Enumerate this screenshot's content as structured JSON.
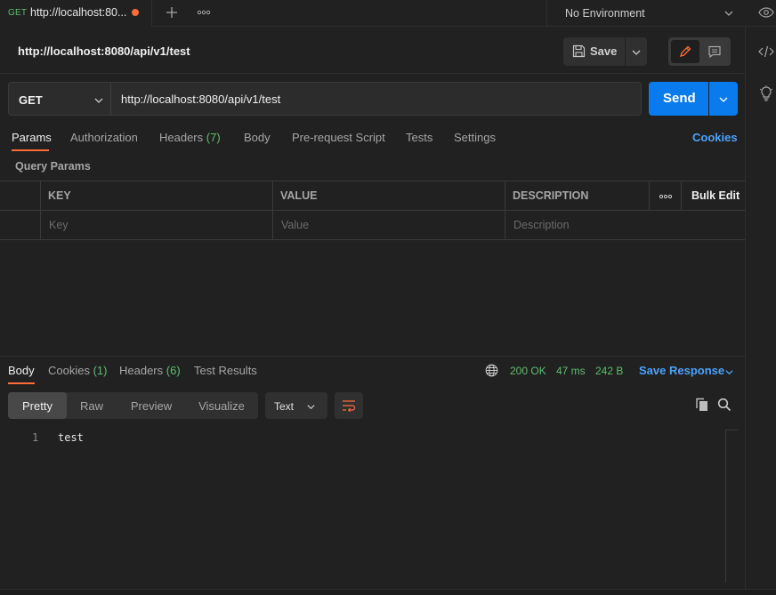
{
  "tab": {
    "method": "GET",
    "title": "http://localhost:80...",
    "unsaved_color": "#ff6c37"
  },
  "environment": {
    "selected": "No Environment"
  },
  "request": {
    "title": "http://localhost:8080/api/v1/test",
    "save_label": "Save",
    "method": "GET",
    "url": "http://localhost:8080/api/v1/test",
    "send_label": "Send"
  },
  "request_tabs": {
    "params": "Params",
    "authorization": "Authorization",
    "headers": "Headers",
    "headers_count": "(7)",
    "body": "Body",
    "prerequest": "Pre-request Script",
    "tests": "Tests",
    "settings": "Settings",
    "cookies": "Cookies"
  },
  "query_params": {
    "title": "Query Params",
    "columns": {
      "key": "KEY",
      "value": "VALUE",
      "description": "DESCRIPTION"
    },
    "bulk_edit": "Bulk Edit",
    "placeholders": {
      "key": "Key",
      "value": "Value",
      "description": "Description"
    }
  },
  "response": {
    "tabs": {
      "body": "Body",
      "cookies": "Cookies",
      "cookies_count": "(1)",
      "headers": "Headers",
      "headers_count": "(6)",
      "test_results": "Test Results"
    },
    "status": "200 OK",
    "time": "47 ms",
    "size": "242 B",
    "save_response": "Save Response",
    "views": {
      "pretty": "Pretty",
      "raw": "Raw",
      "preview": "Preview",
      "visualize": "Visualize"
    },
    "format": "Text",
    "lines": [
      {
        "num": "1",
        "text": "test"
      }
    ]
  },
  "colors": {
    "accent": "#ff6c37",
    "primary": "#097bed",
    "success": "#5ebf6d",
    "link": "#4aa3ff"
  }
}
